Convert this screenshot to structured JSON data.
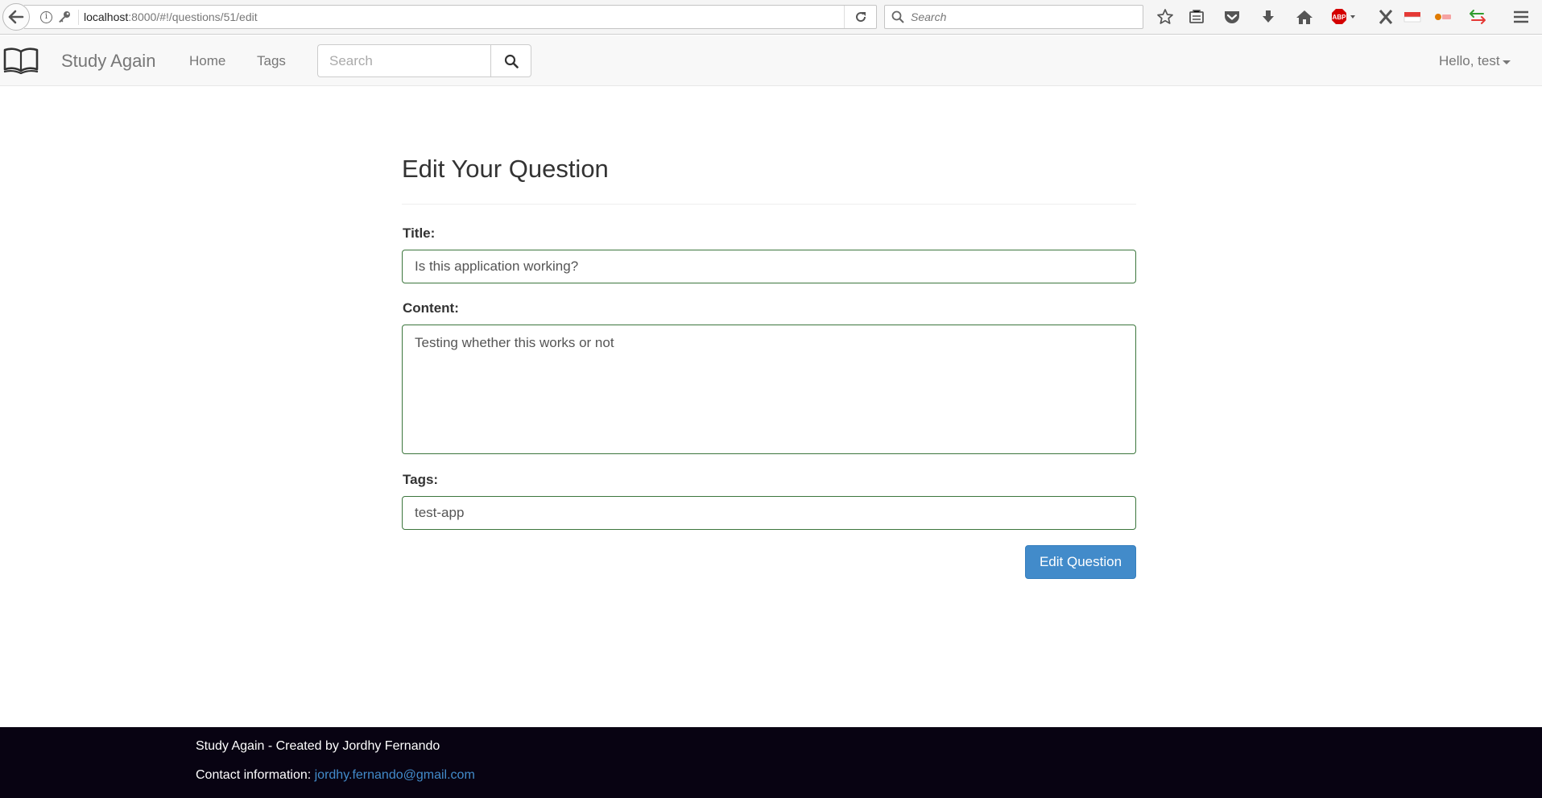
{
  "browser": {
    "url_host": "localhost",
    "url_rest": ":8000/#!/questions/51/edit",
    "search_placeholder": "Search",
    "adblock_label": "ABP"
  },
  "navbar": {
    "brand": "Study Again",
    "links": [
      "Home",
      "Tags"
    ],
    "search_placeholder": "Search",
    "user_greeting": "Hello, test"
  },
  "form": {
    "heading": "Edit Your Question",
    "title_label": "Title:",
    "title_value": "Is this application working?",
    "content_label": "Content:",
    "content_value": "Testing whether this works or not",
    "tags_label": "Tags:",
    "tags_value": "test-app",
    "submit_label": "Edit Question",
    "valid_border_color": "#3c763d"
  },
  "footer": {
    "credit": "Study Again - Created by Jordhy Fernando",
    "contact_label": "Contact information: ",
    "contact_email": "jordhy.fernando@gmail.com",
    "background": "#080312",
    "link_color": "#428bca"
  }
}
